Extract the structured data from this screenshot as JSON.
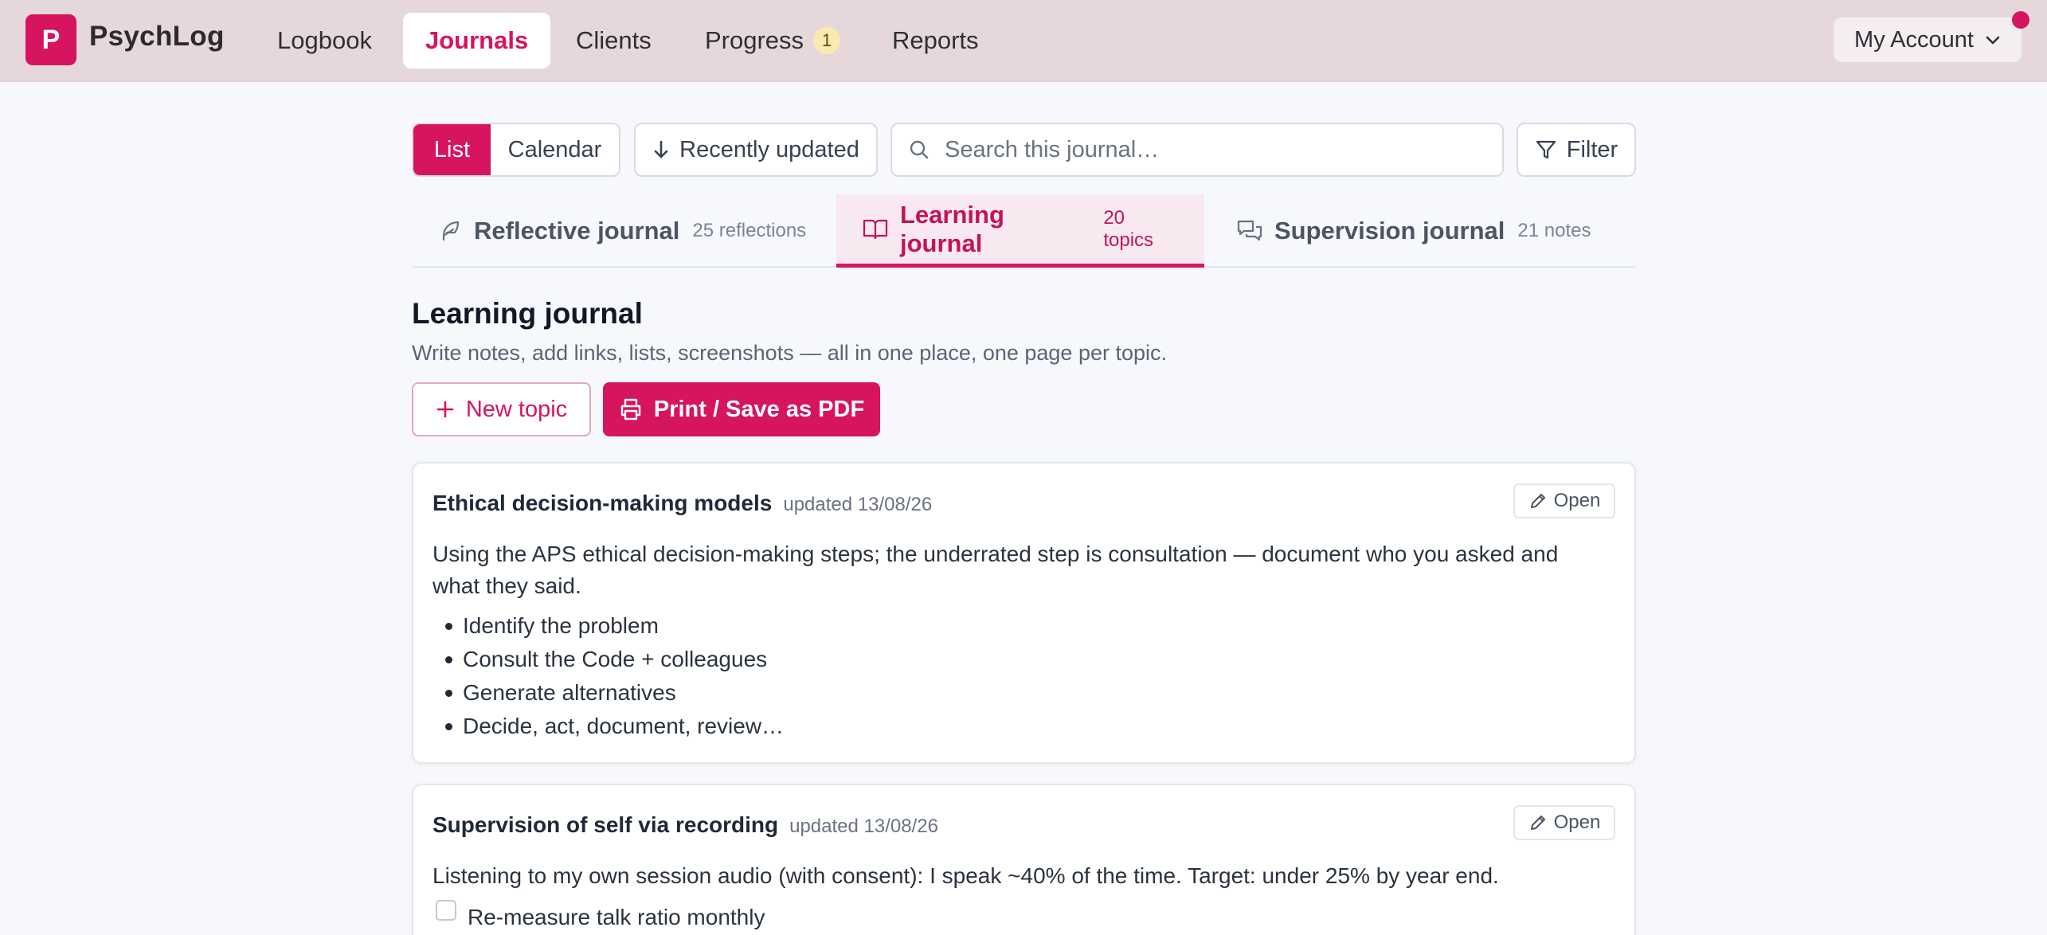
{
  "app": {
    "logo_letter": "P",
    "name": "PsychLog"
  },
  "nav": {
    "items": [
      {
        "label": "Logbook"
      },
      {
        "label": "Journals",
        "active": true
      },
      {
        "label": "Clients"
      },
      {
        "label": "Progress",
        "badge": "1"
      },
      {
        "label": "Reports"
      }
    ],
    "account_label": "My Account"
  },
  "toolbar": {
    "view_list": "List",
    "view_calendar": "Calendar",
    "sort_label": "Recently updated",
    "search_placeholder": "Search this journal…",
    "filter_label": "Filter"
  },
  "tabs": [
    {
      "label": "Reflective journal",
      "count": "25 reflections",
      "icon": "feather-icon"
    },
    {
      "label": "Learning journal",
      "count": "20 topics",
      "icon": "book-open-icon",
      "active": true
    },
    {
      "label": "Supervision journal",
      "count": "21 notes",
      "icon": "chat-bubbles-icon"
    }
  ],
  "section": {
    "title": "Learning journal",
    "subtitle": "Write notes, add links, lists, screenshots — all in one place, one page per topic.",
    "new_button": "New topic",
    "print_button": "Print / Save as PDF"
  },
  "cards": [
    {
      "title": "Ethical decision-making models",
      "updated": "updated 13/08/26",
      "open_label": "Open",
      "body": "Using the APS ethical decision-making steps; the underrated step is consultation — document who you asked and what they said.",
      "bullets": [
        "Identify the problem",
        "Consult the Code + colleagues",
        "Generate alternatives",
        "Decide, act, document, review…"
      ]
    },
    {
      "title": "Supervision of self via recording",
      "updated": "updated 13/08/26",
      "open_label": "Open",
      "body": "Listening to my own session audio (with consent): I speak ~40% of the time. Target: under 25% by year end.",
      "checklist": [
        {
          "label": "Re-measure talk ratio monthly",
          "checked": false
        }
      ]
    }
  ],
  "colors": {
    "accent": "#d6145f",
    "topbar": "#e6d8da",
    "background": "#f7f8fb"
  }
}
